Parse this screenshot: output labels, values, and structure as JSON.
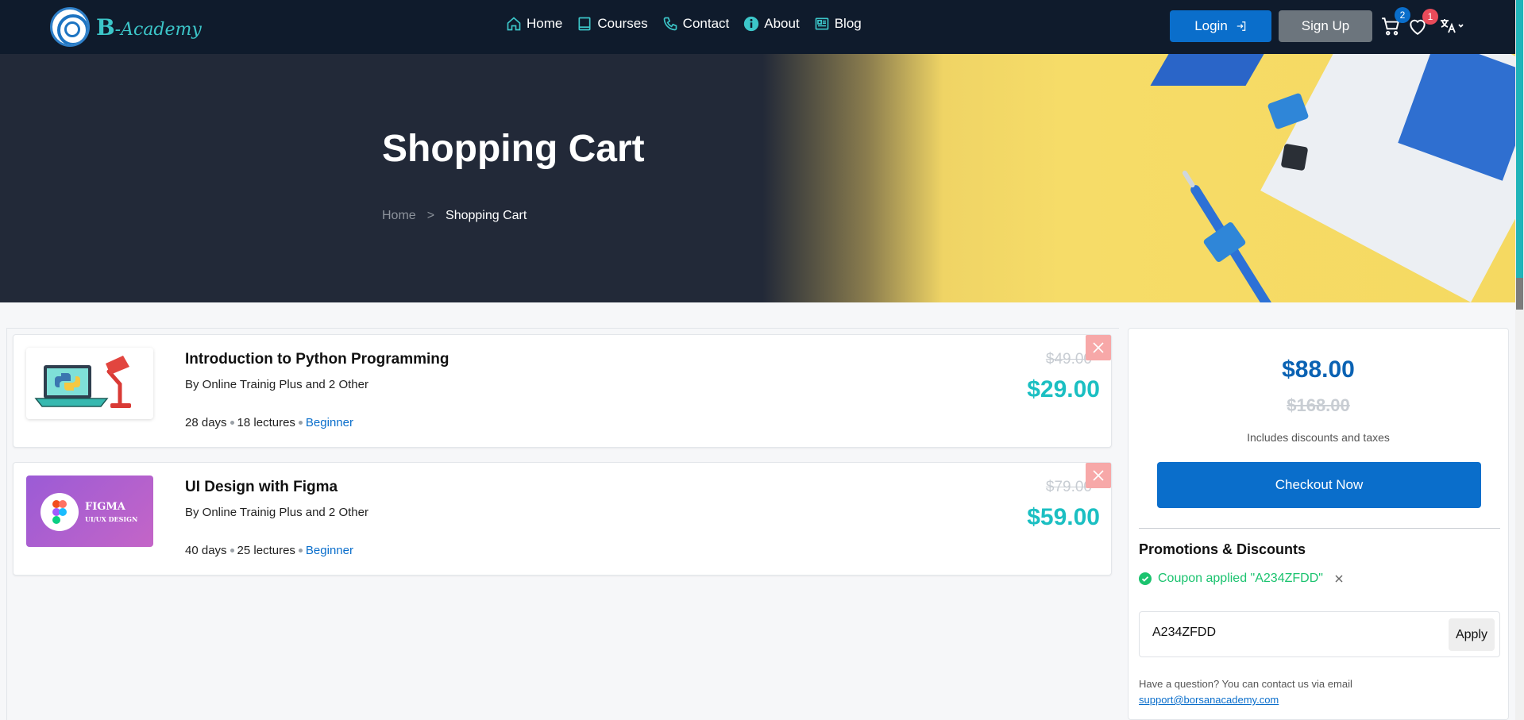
{
  "brand": {
    "letter": "B",
    "rest": "-Academy"
  },
  "nav": [
    {
      "label": "Home",
      "icon": "home-icon"
    },
    {
      "label": "Courses",
      "icon": "book-icon"
    },
    {
      "label": "Contact",
      "icon": "phone-icon"
    },
    {
      "label": "About",
      "icon": "info-icon"
    },
    {
      "label": "Blog",
      "icon": "newspaper-icon"
    }
  ],
  "header": {
    "login_label": "Login",
    "signup_label": "Sign Up",
    "cart_count": "2",
    "wishlist_count": "1"
  },
  "hero": {
    "title": "Shopping Cart",
    "breadcrumb_home": "Home",
    "breadcrumb_sep": ">",
    "breadcrumb_current": "Shopping Cart"
  },
  "cart": {
    "items": [
      {
        "title": "Introduction to Python Programming",
        "by": "By Online Trainig Plus and 2 Other",
        "duration": "28 days",
        "lectures": "18 lectures",
        "level": "Beginner",
        "old_price": "$49.00",
        "price": "$29.00"
      },
      {
        "title": "UI Design with Figma",
        "by": "By Online Trainig Plus and 2 Other",
        "duration": "40 days",
        "lectures": "25 lectures",
        "level": "Beginner",
        "old_price": "$79.00",
        "price": "$59.00",
        "thumb_title": "FIGMA",
        "thumb_subtitle": "UI/UX DESIGN"
      }
    ]
  },
  "summary": {
    "total": "$88.00",
    "old_total": "$168.00",
    "note": "Includes discounts and taxes",
    "checkout_label": "Checkout Now",
    "promo_title": "Promotions & Discounts",
    "coupon_applied": "Coupon applied \"A234ZFDD\"",
    "coupon_value": "A234ZFDD",
    "apply_label": "Apply",
    "question": "Have a question? You can contact us via email",
    "email": "support@borsanacademy.com"
  },
  "colors": {
    "navbar": "#0f1b2c",
    "primary": "#0a6ecb",
    "teal": "#1bbfc2",
    "success": "#1bc36f"
  }
}
